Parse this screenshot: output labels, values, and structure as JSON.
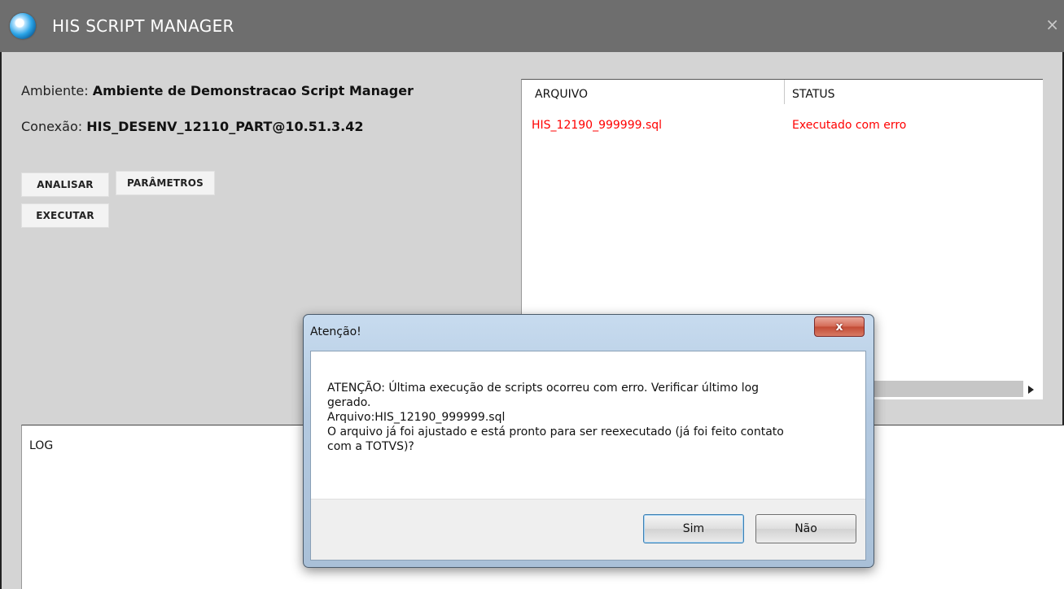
{
  "window": {
    "title": "HIS SCRIPT MANAGER",
    "close_glyph": "×",
    "logo_icon": "app-globe-logo"
  },
  "info": {
    "ambiente_label": "Ambiente:",
    "ambiente_value": "Ambiente de Demonstracao Script Manager",
    "conexao_label": "Conexão:",
    "conexao_value": "HIS_DESENV_12110_PART@10.51.3.42"
  },
  "actions": {
    "analisar": "ANALISAR",
    "parametros": "PARÂMETROS",
    "executar": "EXECUTAR"
  },
  "files_table": {
    "columns": [
      "ARQUIVO",
      "STATUS"
    ],
    "rows": [
      {
        "arquivo": "HIS_12190_999999.sql",
        "status": "Executado com erro"
      }
    ],
    "error_color": "#ff0000"
  },
  "log": {
    "title": "LOG"
  },
  "dialog": {
    "title": "Atenção!",
    "close_glyph": "x",
    "message": "ATENÇÃO: Última execução de scripts ocorreu com erro. Verificar último log\ngerado.\n Arquivo:HIS_12190_999999.sql\nO arquivo já foi ajustado e está pronto para ser reexecutado (já foi feito contato\ncom a TOTVS)?",
    "yes_label": "Sim",
    "no_label": "Não"
  }
}
